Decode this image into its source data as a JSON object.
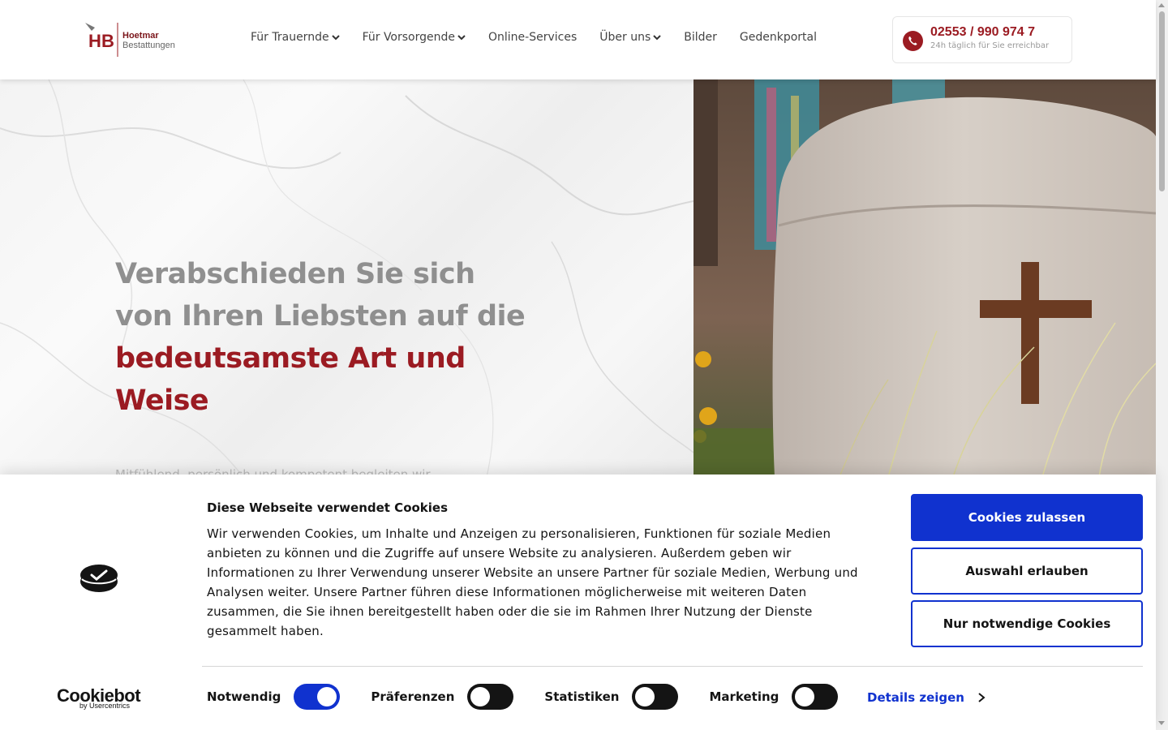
{
  "header": {
    "logo": {
      "line1": "Hoetmar",
      "line2": "Bestattungen",
      "mark": "HB"
    },
    "nav": [
      {
        "label": "Für Trauernde",
        "dropdown": true
      },
      {
        "label": "Für Vorsorgende",
        "dropdown": true
      },
      {
        "label": "Online-Services",
        "dropdown": false
      },
      {
        "label": "Über uns",
        "dropdown": true
      },
      {
        "label": "Bilder",
        "dropdown": false
      },
      {
        "label": "Gedenkportal",
        "dropdown": false
      }
    ],
    "phone": {
      "number": "02553 / 990 974 7",
      "subtitle": "24h täglich für Sie erreichbar",
      "icon": "phone-icon"
    }
  },
  "hero": {
    "title_line1": "Verabschieden Sie sich",
    "title_line2": "von Ihren Liebsten auf die",
    "title_accent_line1": "bedeutsamste Art und",
    "title_accent_line2": "Weise",
    "subtitle": "Mitfühlend, persönlich und kompetent begleiten wir",
    "image_alt": "urn-with-cross"
  },
  "cookie_banner": {
    "title": "Diese Webseite verwendet Cookies",
    "text": "Wir verwenden Cookies, um Inhalte und Anzeigen zu personalisieren, Funktionen für soziale Medien anbieten zu können und die Zugriffe auf unsere Website zu analysieren. Außerdem geben wir Informationen zu Ihrer Verwendung unserer Website an unsere Partner für soziale Medien, Werbung und Analysen weiter. Unsere Partner führen diese Informationen möglicherweise mit weiteren Daten zusammen, die Sie ihnen bereitgestellt haben oder die sie im Rahmen Ihrer Nutzung der Dienste gesammelt haben.",
    "buttons": {
      "accept_all": "Cookies zulassen",
      "allow_selection": "Auswahl erlauben",
      "necessary_only": "Nur notwendige Cookies"
    },
    "toggles": [
      {
        "label": "Notwendig",
        "on": true
      },
      {
        "label": "Präferenzen",
        "on": false
      },
      {
        "label": "Statistiken",
        "on": false
      },
      {
        "label": "Marketing",
        "on": false
      }
    ],
    "details_link": "Details zeigen",
    "brand": "Cookiebot",
    "brand_sub": "by Usercentrics"
  },
  "colors": {
    "brand_red": "#9b1b22",
    "cookie_blue": "#1032cf",
    "text_dark": "#141414",
    "hero_grey": "#8f8f8f"
  }
}
